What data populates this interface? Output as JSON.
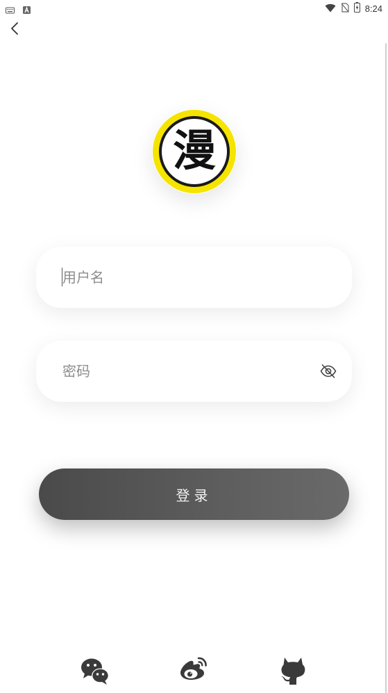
{
  "status_bar": {
    "time": "8:24",
    "left_icons": [
      "keyboard-icon",
      "a-notification-icon"
    ],
    "right_icons": [
      "wifi-icon",
      "no-sim-icon",
      "battery-icon"
    ]
  },
  "nav": {
    "back_icon": "chevron-left-icon"
  },
  "logo": {
    "character": "漫",
    "ring_color": "#F5E400"
  },
  "form": {
    "username": {
      "placeholder": "用户名",
      "value": ""
    },
    "password": {
      "placeholder": "密码",
      "value": "",
      "toggle_icon": "eye-off-icon"
    },
    "login_label": "登录"
  },
  "social_login": [
    {
      "name": "wechat",
      "icon": "wechat-icon"
    },
    {
      "name": "weibo",
      "icon": "weibo-icon"
    },
    {
      "name": "github",
      "icon": "github-icon"
    }
  ],
  "colors": {
    "button_gradient_start": "#4a4a4a",
    "button_gradient_end": "#6a6a6a",
    "icon_color": "#3a3a3a"
  }
}
